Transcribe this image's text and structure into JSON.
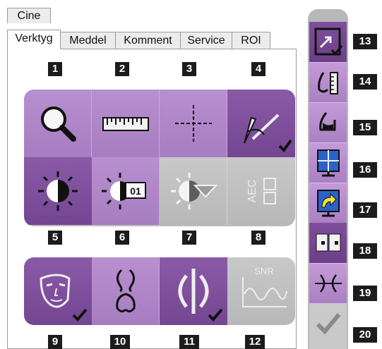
{
  "tabs": {
    "cine": "Cine",
    "items": [
      "Verktyg",
      "Meddel",
      "Komment",
      "Service",
      "ROI"
    ],
    "active": "Verktyg"
  },
  "tool_numbers": [
    "1",
    "2",
    "3",
    "4",
    "5",
    "6",
    "7",
    "8",
    "9",
    "10",
    "11",
    "12"
  ],
  "toolbar_numbers": [
    "13",
    "14",
    "15",
    "16",
    "17",
    "18",
    "19",
    "20"
  ],
  "icons": {
    "t1": "magnifier-icon",
    "t2": "ruler-icon",
    "t3": "crosshair-icon",
    "t4": "scalpel-tools-icon",
    "t5": "contrast-icon",
    "t6": "contrast-preset-icon",
    "t7": "contrast-roi-icon",
    "t8": "aec-icon",
    "t9": "face-mask-icon",
    "t10": "breast-implant-icon",
    "t11": "invert-icon",
    "t12": "snr-icon",
    "r13": "fit-view-icon",
    "r14": "measure-breast-icon",
    "r15": "breast-marker-icon",
    "r16": "quad-view-icon",
    "r17": "swap-view-icon",
    "r18": "side-by-side-icon",
    "r19": "merge-icon",
    "r20": "accept-icon"
  },
  "labels": {
    "aec": "AEC",
    "snr": "SNR",
    "preset": "01"
  },
  "colors": {
    "light_purple": "#a77dc2",
    "dark_purple": "#744692",
    "grey": "#bcbcbc",
    "number_badge": "#1c1c1c"
  }
}
